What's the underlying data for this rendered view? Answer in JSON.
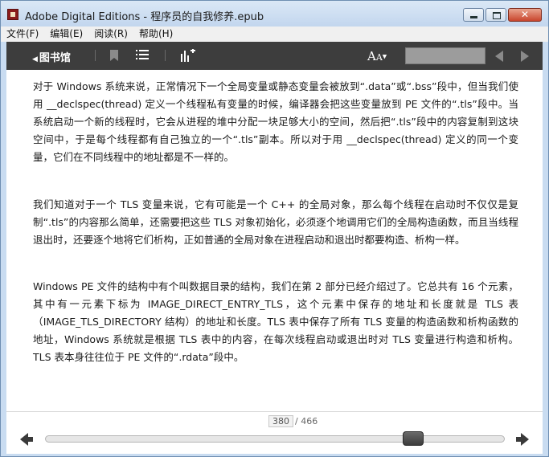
{
  "window": {
    "title": "Adobe Digital Editions - 程序员的自我修养.epub",
    "controls": {
      "minimize": "",
      "maximize": "",
      "close": "✕"
    }
  },
  "menu": {
    "items": [
      "文件(F)",
      "编辑(E)",
      "阅读(R)",
      "帮助(H)"
    ]
  },
  "toolbar": {
    "back_label": "图书馆",
    "font_size_big": "A",
    "font_size_small": "A",
    "search_placeholder": "",
    "icons": [
      "left-triangle-icon",
      "bookmark-icon",
      "list-icon",
      "chart-icon",
      "font-size-icon",
      "prev-page-icon",
      "next-page-icon"
    ]
  },
  "content": {
    "paragraphs": [
      "对于 Windows 系统来说，正常情况下一个全局变量或静态变量会被放到“.data”或“.bss”段中，但当我们使用 __declspec(thread) 定义一个线程私有变量的时候，编译器会把这些变量放到 PE 文件的“.tls”段中。当系统启动一个新的线程时，它会从进程的堆中分配一块足够大小的空间，然后把“.tls”段中的内容复制到这块空间中，于是每个线程都有自己独立的一个“.tls”副本。所以对于用 __declspec(thread) 定义的同一个变量，它们在不同线程中的地址都是不一样的。",
      "我们知道对于一个 TLS 变量来说，它有可能是一个 C++ 的全局对象，那么每个线程在启动时不仅仅是复制“.tls”的内容那么简单，还需要把这些 TLS 对象初始化，必须逐个地调用它们的全局构造函数，而且当线程退出时，还要逐个地将它们析构，正如普通的全局对象在进程启动和退出时都要构造、析构一样。",
      "Windows PE 文件的结构中有个叫数据目录的结构，我们在第 2 部分已经介绍过了。它总共有 16 个元素，其中有一元素下标为 IMAGE_DIRECT_ENTRY_TLS，这个元素中保存的地址和长度就是 TLS 表（IMAGE_TLS_DIRECTORY 结构）的地址和长度。TLS 表中保存了所有 TLS 变量的构造函数和析构函数的地址，Windows 系统就是根据 TLS 表中的内容，在每次线程启动或退出时对 TLS 变量进行构造和析构。TLS 表本身往往位于 PE 文件的“.rdata”段中。"
    ]
  },
  "footer": {
    "current_page": "380",
    "total_pages": "/ 466",
    "progress_fraction": 0.815
  },
  "colors": {
    "toolbar_bg": "#3d3d3d",
    "title_bg": "#c9dcf1",
    "content_bg": "#ffffff"
  }
}
